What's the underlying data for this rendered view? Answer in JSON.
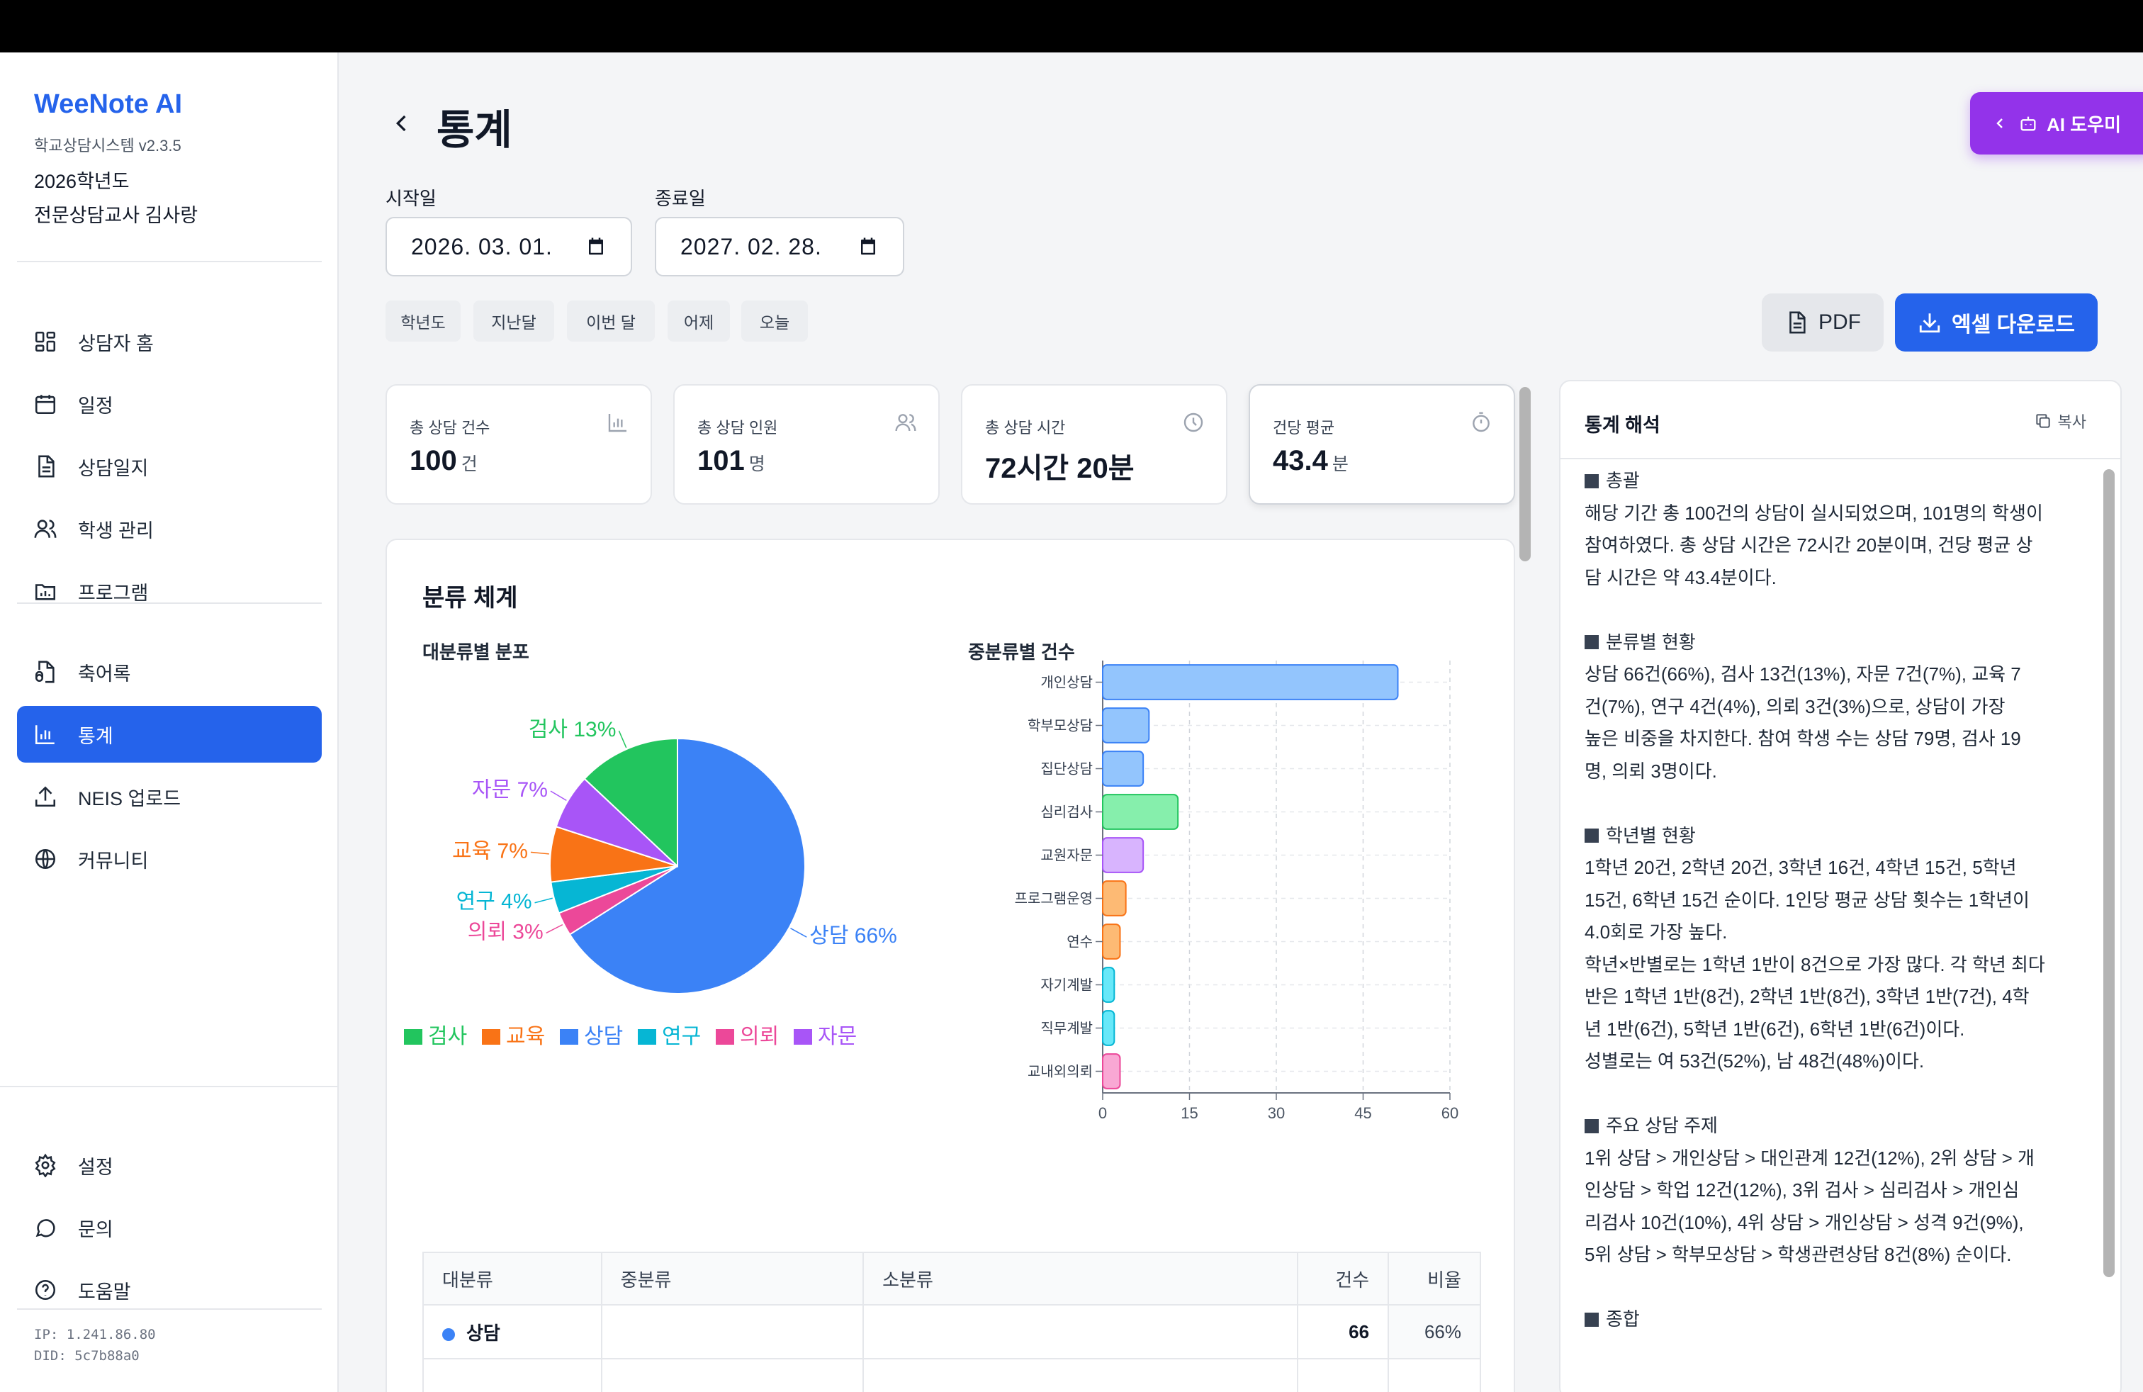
{
  "sidebar": {
    "brand": "WeeNote AI",
    "version": "학교상담시스템 v2.3.5",
    "year": "2026학년도",
    "teacher": "전문상담교사 김사랑",
    "items": [
      {
        "label": "상담자 홈",
        "icon": "dashboard-icon"
      },
      {
        "label": "일정",
        "icon": "calendar-icon"
      },
      {
        "label": "상담일지",
        "icon": "document-icon"
      },
      {
        "label": "학생 관리",
        "icon": "users-icon"
      },
      {
        "label": "프로그램",
        "icon": "folder-chart-icon"
      },
      {
        "label": "축어록",
        "icon": "audio-file-icon"
      },
      {
        "label": "통계",
        "icon": "bar-chart-icon",
        "active": true
      },
      {
        "label": "NEIS 업로드",
        "icon": "upload-icon"
      },
      {
        "label": "커뮤니티",
        "icon": "globe-icon"
      }
    ],
    "bottom_items": [
      {
        "label": "설정",
        "icon": "gear-icon"
      },
      {
        "label": "문의",
        "icon": "chat-icon"
      },
      {
        "label": "도움말",
        "icon": "help-icon"
      }
    ],
    "ip": "IP: 1.241.86.80",
    "did": "DID: 5c7b88a0"
  },
  "header": {
    "title": "통계",
    "ai_button": "AI 도우미"
  },
  "filters": {
    "start_label": "시작일",
    "start_value": "2026. 03. 01.",
    "end_label": "종료일",
    "end_value": "2027. 02. 28.",
    "chips": [
      "학년도",
      "지난달",
      "이번 달",
      "어제",
      "오늘"
    ],
    "pdf_label": "PDF",
    "excel_label": "엑셀 다운로드"
  },
  "stats": [
    {
      "label": "총 상담 건수",
      "value": "100",
      "unit": "건",
      "icon": "bar-chart-icon"
    },
    {
      "label": "총 상담 인원",
      "value": "101",
      "unit": "명",
      "icon": "users-icon"
    },
    {
      "label": "총 상담 시간",
      "value": "72시간 20분",
      "unit": "",
      "icon": "clock-icon"
    },
    {
      "label": "건당 평균",
      "value": "43.4",
      "unit": "분",
      "icon": "timer-icon"
    }
  ],
  "classification": {
    "title": "분류 체계",
    "pie_title": "대분류별 분포",
    "bar_title": "중분류별 건수"
  },
  "chart_data": [
    {
      "type": "pie",
      "title": "대분류별 분포",
      "slices": [
        {
          "name": "상담",
          "value": 66,
          "label": "상담 66%",
          "color": "#3b82f6"
        },
        {
          "name": "의뢰",
          "value": 3,
          "label": "의뢰 3%",
          "color": "#ec4899"
        },
        {
          "name": "연구",
          "value": 4,
          "label": "연구 4%",
          "color": "#06b6d4"
        },
        {
          "name": "교육",
          "value": 7,
          "label": "교육 7%",
          "color": "#f97316"
        },
        {
          "name": "자문",
          "value": 7,
          "label": "자문 7%",
          "color": "#a855f7"
        },
        {
          "name": "검사",
          "value": 13,
          "label": "검사 13%",
          "color": "#22c55e"
        }
      ],
      "legend": [
        {
          "name": "검사",
          "color": "#22c55e"
        },
        {
          "name": "교육",
          "color": "#f97316"
        },
        {
          "name": "상담",
          "color": "#3b82f6"
        },
        {
          "name": "연구",
          "color": "#06b6d4"
        },
        {
          "name": "의뢰",
          "color": "#ec4899"
        },
        {
          "name": "자문",
          "color": "#a855f7"
        }
      ],
      "legend_position": "bottom"
    },
    {
      "type": "bar",
      "orientation": "horizontal",
      "title": "중분류별 건수",
      "categories": [
        "개인상담",
        "학부모상담",
        "집단상담",
        "심리검사",
        "교원자문",
        "프로그램운영",
        "연수",
        "자기계발",
        "직무계발",
        "교내외의뢰"
      ],
      "values": [
        51,
        8,
        7,
        13,
        7,
        4,
        3,
        2,
        2,
        3
      ],
      "colors": [
        "#93c5fd",
        "#93c5fd",
        "#93c5fd",
        "#86efac",
        "#d8b4fe",
        "#fdba74",
        "#fdba74",
        "#67e8f9",
        "#67e8f9",
        "#f9a8d4"
      ],
      "border_colors": [
        "#3b82f6",
        "#3b82f6",
        "#3b82f6",
        "#22c55e",
        "#a855f7",
        "#f97316",
        "#f97316",
        "#06b6d4",
        "#06b6d4",
        "#ec4899"
      ],
      "xlim": [
        0,
        60
      ],
      "xticks": [
        "0",
        "15",
        "30",
        "45",
        "60"
      ],
      "grid": true
    }
  ],
  "table": {
    "headers": [
      "대분류",
      "중분류",
      "소분류",
      "건수",
      "비율"
    ],
    "rows": [
      {
        "major": "상담",
        "mid": "",
        "minor": "",
        "count": "66",
        "ratio": "66%",
        "color": "#3b82f6"
      }
    ]
  },
  "interpretation": {
    "title": "통계 해석",
    "copy_label": "복사",
    "sections": [
      {
        "heading": "총괄",
        "lines": [
          "해당 기간 총 100건의 상담이 실시되었으며, 101명의 학생이",
          "참여하였다. 총 상담 시간은 72시간 20분이며, 건당 평균 상",
          "담 시간은 약 43.4분이다."
        ]
      },
      {
        "heading": "분류별 현황",
        "lines": [
          "상담 66건(66%), 검사 13건(13%), 자문 7건(7%), 교육 7",
          "건(7%), 연구 4건(4%), 의뢰 3건(3%)으로, 상담이 가장",
          "높은 비중을 차지한다. 참여 학생 수는 상담 79명, 검사 19",
          "명, 의뢰 3명이다."
        ]
      },
      {
        "heading": "학년별 현황",
        "lines": [
          "1학년 20건, 2학년 20건, 3학년 16건, 4학년 15건, 5학년",
          "15건, 6학년 15건 순이다. 1인당 평균 상담 횟수는 1학년이",
          "4.0회로 가장 높다.",
          "학년×반별로는 1학년 1반이 8건으로 가장 많다. 각 학년 최다",
          "반은 1학년 1반(8건), 2학년 1반(8건), 3학년 1반(7건), 4학",
          "년 1반(6건), 5학년 1반(6건), 6학년 1반(6건)이다.",
          "성별로는 여 53건(52%), 남 48건(48%)이다."
        ]
      },
      {
        "heading": "주요 상담 주제",
        "lines": [
          "1위 상담 > 개인상담 > 대인관계 12건(12%), 2위 상담 > 개",
          "인상담 > 학업 12건(12%), 3위 검사 > 심리검사 > 개인심",
          "리검사 10건(10%), 4위 상담 > 개인상담 > 성격 9건(9%),",
          "5위 상담 > 학부모상담 > 학생관련상담 8건(8%) 순이다."
        ]
      },
      {
        "heading": "종합",
        "lines": []
      }
    ]
  }
}
